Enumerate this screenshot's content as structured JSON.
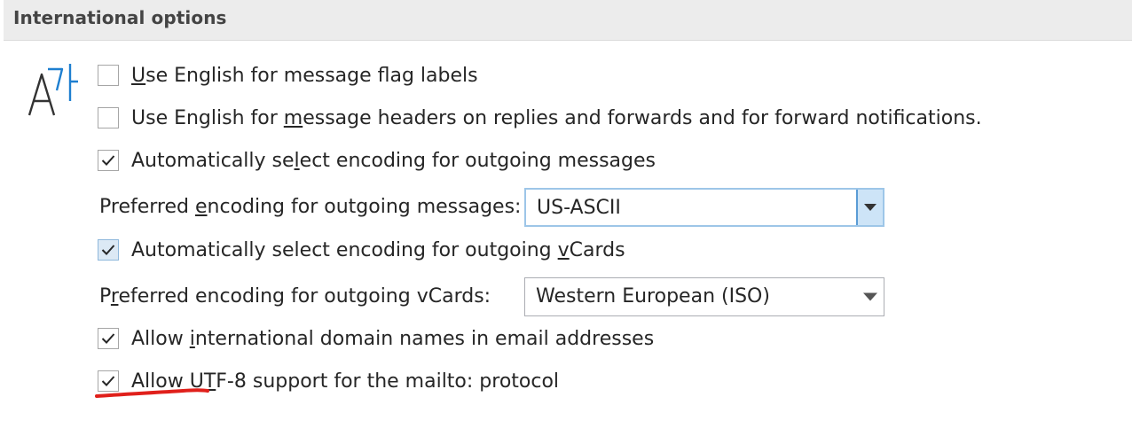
{
  "section": {
    "title": "International options"
  },
  "options": {
    "flag_labels": {
      "pre": "",
      "accel": "U",
      "post": "se English for message flag labels",
      "checked": false
    },
    "headers_english": {
      "pre": "Use English for ",
      "accel": "m",
      "post": "essage headers on replies and forwards and for forward notifications.",
      "checked": false
    },
    "auto_encoding_messages": {
      "pre": "Automatically se",
      "accel": "l",
      "post": "ect encoding for outgoing messages",
      "checked": true
    },
    "pref_encoding_messages": {
      "label_pre": "Preferred ",
      "label_accel": "e",
      "label_post": "ncoding for outgoing messages:",
      "value": "US-ASCII"
    },
    "auto_encoding_vcards": {
      "pre": "Automatically select encoding for outgoing ",
      "accel": "v",
      "post": "Cards",
      "checked": true
    },
    "pref_encoding_vcards": {
      "label_pre": "P",
      "label_accel": "r",
      "label_post": "eferred encoding for outgoing vCards:",
      "value": "Western European (ISO)"
    },
    "intl_domain_names": {
      "pre": "Allow ",
      "accel": "i",
      "post": "nternational domain names in email addresses",
      "checked": true
    },
    "utf8_mailto": {
      "pre": "Allow U",
      "accel": "T",
      "post": "F-8 support for the mailto: protocol",
      "checked": true
    }
  },
  "icons": {
    "section_icon": "international-language-icon",
    "check": "checkmark-icon",
    "dropdown": "chevron-down-icon"
  },
  "colors": {
    "header_bg": "#ececec",
    "text": "#262626",
    "icon_blue": "#1e7fd0",
    "focus_blue": "#5a9bd5",
    "annotation_red": "#e0201b"
  }
}
